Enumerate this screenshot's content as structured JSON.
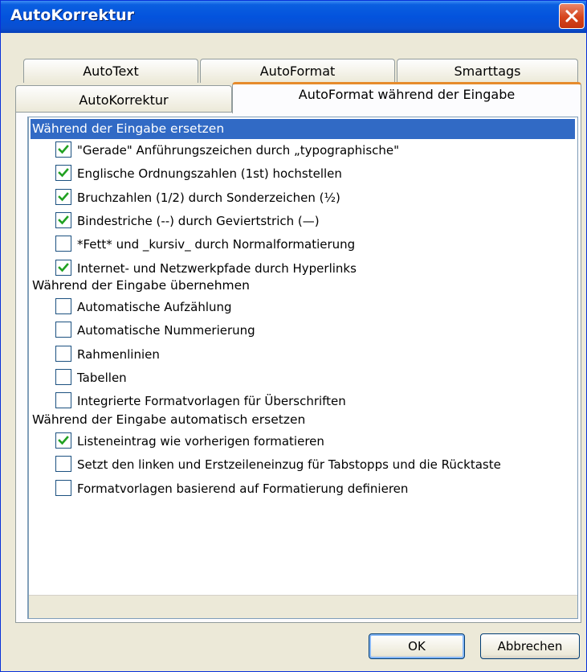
{
  "window": {
    "title": "AutoKorrektur"
  },
  "tabs": {
    "row1": [
      "AutoText",
      "AutoFormat",
      "Smarttags"
    ],
    "row2": [
      "AutoKorrektur",
      "AutoFormat während der Eingabe"
    ]
  },
  "groups": [
    {
      "header": "Während der Eingabe ersetzen",
      "items": [
        {
          "label": "\"Gerade\" Anführungszeichen durch „typographische\"",
          "checked": true
        },
        {
          "label": "Englische Ordnungszahlen (1st) hochstellen",
          "checked": true
        },
        {
          "label": "Bruchzahlen (1/2) durch Sonderzeichen (½)",
          "checked": true
        },
        {
          "label": "Bindestriche (--) durch Geviertstrich (—)",
          "checked": true
        },
        {
          "label": "*Fett* und _kursiv_ durch Normalformatierung",
          "checked": false
        },
        {
          "label": "Internet- und Netzwerkpfade durch Hyperlinks",
          "checked": true
        }
      ]
    },
    {
      "header": "Während der Eingabe übernehmen",
      "items": [
        {
          "label": "Automatische Aufzählung",
          "checked": false
        },
        {
          "label": "Automatische Nummerierung",
          "checked": false
        },
        {
          "label": "Rahmenlinien",
          "checked": false
        },
        {
          "label": "Tabellen",
          "checked": false
        },
        {
          "label": "Integrierte Formatvorlagen für Überschriften",
          "checked": false
        }
      ]
    },
    {
      "header": "Während der Eingabe automatisch ersetzen",
      "items": [
        {
          "label": "Listeneintrag wie vorherigen formatieren",
          "checked": true
        },
        {
          "label": "Setzt den linken und Erstzeileneinzug für Tabstopps und die Rücktaste",
          "checked": false
        },
        {
          "label": "Formatvorlagen basierend auf Formatierung definieren",
          "checked": false
        }
      ]
    }
  ],
  "buttons": {
    "ok": "OK",
    "cancel": "Abbrechen"
  }
}
